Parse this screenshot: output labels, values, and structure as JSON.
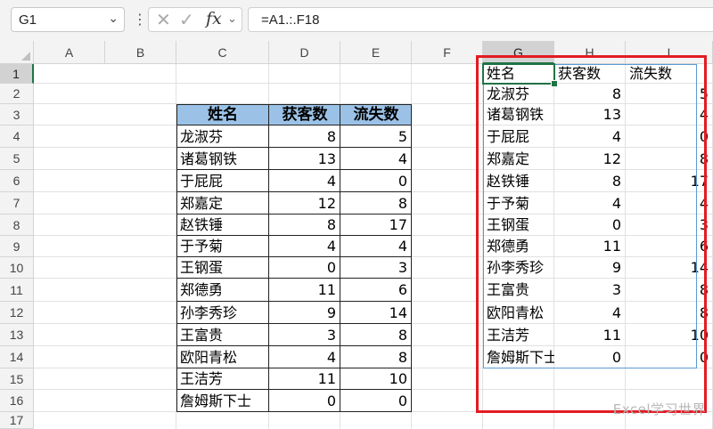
{
  "formula_bar": {
    "name_box": "G1",
    "formula": "=A1.:.F18"
  },
  "icons": {
    "name_box_dropdown": "chevron-down-icon",
    "more_options": "more-options-icon",
    "cancel": "cancel-x-icon",
    "enter": "checkmark-icon",
    "insert_function": "fx-icon"
  },
  "columns": [
    "A",
    "B",
    "C",
    "D",
    "E",
    "F",
    "G",
    "H",
    "I"
  ],
  "rows": [
    "1",
    "2",
    "3",
    "4",
    "5",
    "6",
    "7",
    "8",
    "9",
    "10",
    "11",
    "12",
    "13",
    "14",
    "15",
    "16",
    "17"
  ],
  "source_table": {
    "headers": [
      "姓名",
      "获客数",
      "流失数"
    ],
    "rows": [
      [
        "龙淑芬",
        "8",
        "5"
      ],
      [
        "诸葛钢铁",
        "13",
        "4"
      ],
      [
        "于屁屁",
        "4",
        "0"
      ],
      [
        "郑嘉定",
        "12",
        "8"
      ],
      [
        "赵铁锤",
        "8",
        "17"
      ],
      [
        "于予菊",
        "4",
        "4"
      ],
      [
        "王钢蛋",
        "0",
        "3"
      ],
      [
        "郑德勇",
        "11",
        "6"
      ],
      [
        "孙李秀珍",
        "9",
        "14"
      ],
      [
        "王富贵",
        "3",
        "8"
      ],
      [
        "欧阳青松",
        "4",
        "8"
      ],
      [
        "王洁芳",
        "11",
        "10"
      ],
      [
        "詹姆斯下士",
        "0",
        "0"
      ]
    ]
  },
  "spill_table": {
    "headers": [
      "姓名",
      "获客数",
      "流失数"
    ],
    "rows": [
      [
        "龙淑芬",
        "8",
        "5"
      ],
      [
        "诸葛钢铁",
        "13",
        "4"
      ],
      [
        "于屁屁",
        "4",
        "0"
      ],
      [
        "郑嘉定",
        "12",
        "8"
      ],
      [
        "赵铁锤",
        "8",
        "17"
      ],
      [
        "于予菊",
        "4",
        "4"
      ],
      [
        "王钢蛋",
        "0",
        "3"
      ],
      [
        "郑德勇",
        "11",
        "6"
      ],
      [
        "孙李秀珍",
        "9",
        "14"
      ],
      [
        "王富贵",
        "3",
        "8"
      ],
      [
        "欧阳青松",
        "4",
        "8"
      ],
      [
        "王洁芳",
        "11",
        "10"
      ],
      [
        "詹姆斯下士",
        "0",
        "0"
      ]
    ]
  },
  "watermark": "Excel学习世界",
  "colors": {
    "header_fill": "#9bc2e6",
    "highlight_box": "#e31b23",
    "selection": "#217346"
  }
}
